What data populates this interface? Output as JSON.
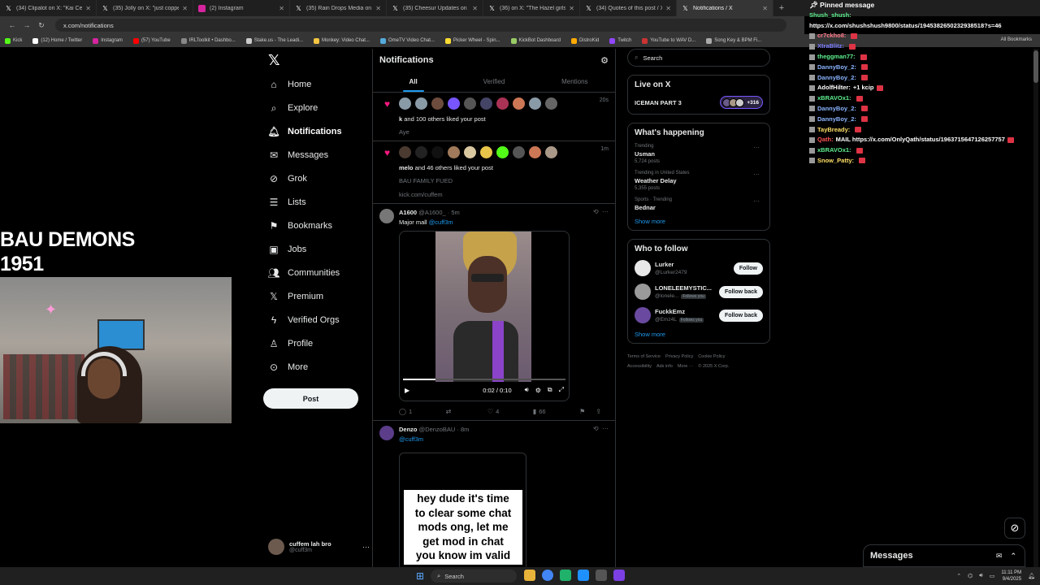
{
  "browser": {
    "tabs": [
      {
        "label": "(34) Clipalot on X: \"Kai Cenat w",
        "active": false
      },
      {
        "label": "(35) Jolly on X: \"just copped a",
        "active": false
      },
      {
        "label": "(2) Instagram",
        "active": false
      },
      {
        "label": "(35) Rain Drops Media on X: \"",
        "active": false
      },
      {
        "label": "(35) Cheesur Updates on X: \"C",
        "active": false
      },
      {
        "label": "(36) on X: \"The Hazel girls bf p",
        "active": false
      },
      {
        "label": "(34) Quotes of this post / X",
        "active": false
      },
      {
        "label": "Notifications / X",
        "active": true
      }
    ],
    "url": "x.com/notifications",
    "bookmarks": [
      "Kick",
      "(12) Home / Twitter",
      "Instagram",
      "(57) YouTube",
      "IRLToolkit • Dashbo...",
      "Stake.us - The Leadi...",
      "Monkey: Video Chat...",
      "OmeTV Video Chat...",
      "Picker Wheel - Spin...",
      "KickBot Dashboard",
      "DistroKid",
      "Twitch",
      "YouTube to WAV D...",
      "Song Key & BPM Fi..."
    ],
    "all_bookmarks": "All Bookmarks"
  },
  "overlay": {
    "title_line1": "BAU DEMONS",
    "title_line2": "1951"
  },
  "nav": {
    "items": [
      {
        "label": "Home",
        "icon": "home-icon"
      },
      {
        "label": "Explore",
        "icon": "search-icon"
      },
      {
        "label": "Notifications",
        "icon": "bell-icon"
      },
      {
        "label": "Messages",
        "icon": "mail-icon"
      },
      {
        "label": "Grok",
        "icon": "grok-icon"
      },
      {
        "label": "Lists",
        "icon": "list-icon"
      },
      {
        "label": "Bookmarks",
        "icon": "bookmark-icon"
      },
      {
        "label": "Jobs",
        "icon": "briefcase-icon"
      },
      {
        "label": "Communities",
        "icon": "people-icon"
      },
      {
        "label": "Premium",
        "icon": "x-icon"
      },
      {
        "label": "Verified Orgs",
        "icon": "lightning-icon"
      },
      {
        "label": "Profile",
        "icon": "person-icon"
      },
      {
        "label": "More",
        "icon": "more-icon"
      }
    ],
    "post_label": "Post",
    "account_name": "cuffem lah bro",
    "account_handle": "@cuff3m"
  },
  "main": {
    "title": "Notifications",
    "tabs": [
      "All",
      "Verified",
      "Mentions"
    ],
    "notif1": {
      "time": "20s",
      "user": "k",
      "text": " and 100 others liked your post",
      "sub": "Aye"
    },
    "notif2": {
      "time": "1m",
      "user": "melo",
      "text": " and 46 others liked your post",
      "sub": "BAU FAMILY FUED",
      "link": "kick.com/cuffem"
    },
    "tweet1": {
      "name": "A1600",
      "handle": "@A1600_",
      "time": "5m",
      "body": "Major mall ",
      "mention": "@cuff3m",
      "video_time": "0:02 / 0:10",
      "replies": "1",
      "likes": "4",
      "views": "66"
    },
    "tweet2": {
      "name": "Denzo",
      "handle": "@DenzoBAU",
      "time": "8m",
      "mention": "@cuff3m",
      "meme": [
        "hey dude it's time",
        "to clear some chat",
        "mods ong, let me",
        "get mod in chat",
        "you know im valid"
      ]
    }
  },
  "right": {
    "search_placeholder": "Search",
    "live_title": "Live on X",
    "live_item": "ICEMAN PART 3",
    "live_count": "+316",
    "happening_title": "What's happening",
    "trends": [
      {
        "context": "Trending",
        "title": "Usman",
        "posts": "5,724 posts"
      },
      {
        "context": "Trending in United States",
        "title": "Weather Delay",
        "posts": "5,355 posts"
      },
      {
        "context": "Sports · Trending",
        "title": "Bednar",
        "posts": ""
      }
    ],
    "show_more": "Show more",
    "who_title": "Who to follow",
    "who": [
      {
        "name": "Lurker",
        "handle": "@Lurker2479",
        "button": "Follow",
        "follows_you": ""
      },
      {
        "name": "LONELEEMYSTIC...",
        "handle": "@lonele...",
        "button": "Follow back",
        "follows_you": "Follows you"
      },
      {
        "name": "FuckkEmz",
        "handle": "@Emz4L",
        "button": "Follow back",
        "follows_you": "Follows you"
      }
    ],
    "footer": [
      "Terms of Service",
      "Privacy Policy",
      "Cookie Policy",
      "Accessibility",
      "Ads info",
      "More ···",
      "© 2025 X Corp."
    ]
  },
  "chat": {
    "pinned_label": "Pinned message",
    "pinned_user": "Shush_shush:",
    "pinned_url": "https://x.com/shushshush9800/status/1945382650232938518?s=46",
    "messages": [
      {
        "user": "cr7ckho8:",
        "color": "#ff7a8a",
        "text": ""
      },
      {
        "user": "XtraBlitz:",
        "color": "#7b7bff",
        "text": ""
      },
      {
        "user": "theggman77:",
        "color": "#5ef08f",
        "text": ""
      },
      {
        "user": "DannyBoy_2:",
        "color": "#8ab4ff",
        "text": ""
      },
      {
        "user": "DannyBoy_2:",
        "color": "#8ab4ff",
        "text": ""
      },
      {
        "user": "AdolfHilter:",
        "color": "#ffffff",
        "text": "+1 kcip"
      },
      {
        "user": "xBRAVOx1:",
        "color": "#5ef08f",
        "text": ""
      },
      {
        "user": "DannyBoy_2:",
        "color": "#8ab4ff",
        "text": ""
      },
      {
        "user": "DannyBoy_2:",
        "color": "#8ab4ff",
        "text": ""
      },
      {
        "user": "TayBready:",
        "color": "#ffe066",
        "text": ""
      },
      {
        "user": "Qath:",
        "color": "#ff5555",
        "text": "MAIL https://x.com/OnlyQath/status/1963715647126257757"
      },
      {
        "user": "xBRAVOx1:",
        "color": "#5ef08f",
        "text": ""
      },
      {
        "user": "Snow_Patty:",
        "color": "#ffe066",
        "text": ""
      }
    ]
  },
  "messages_drawer": {
    "label": "Messages"
  },
  "taskbar": {
    "search": "Search",
    "time": "11:11 PM",
    "date": "9/4/2025"
  },
  "colors": {
    "accent": "#1d9bf0",
    "like": "#f91880",
    "border": "#2f3336",
    "muted": "#71767b"
  }
}
